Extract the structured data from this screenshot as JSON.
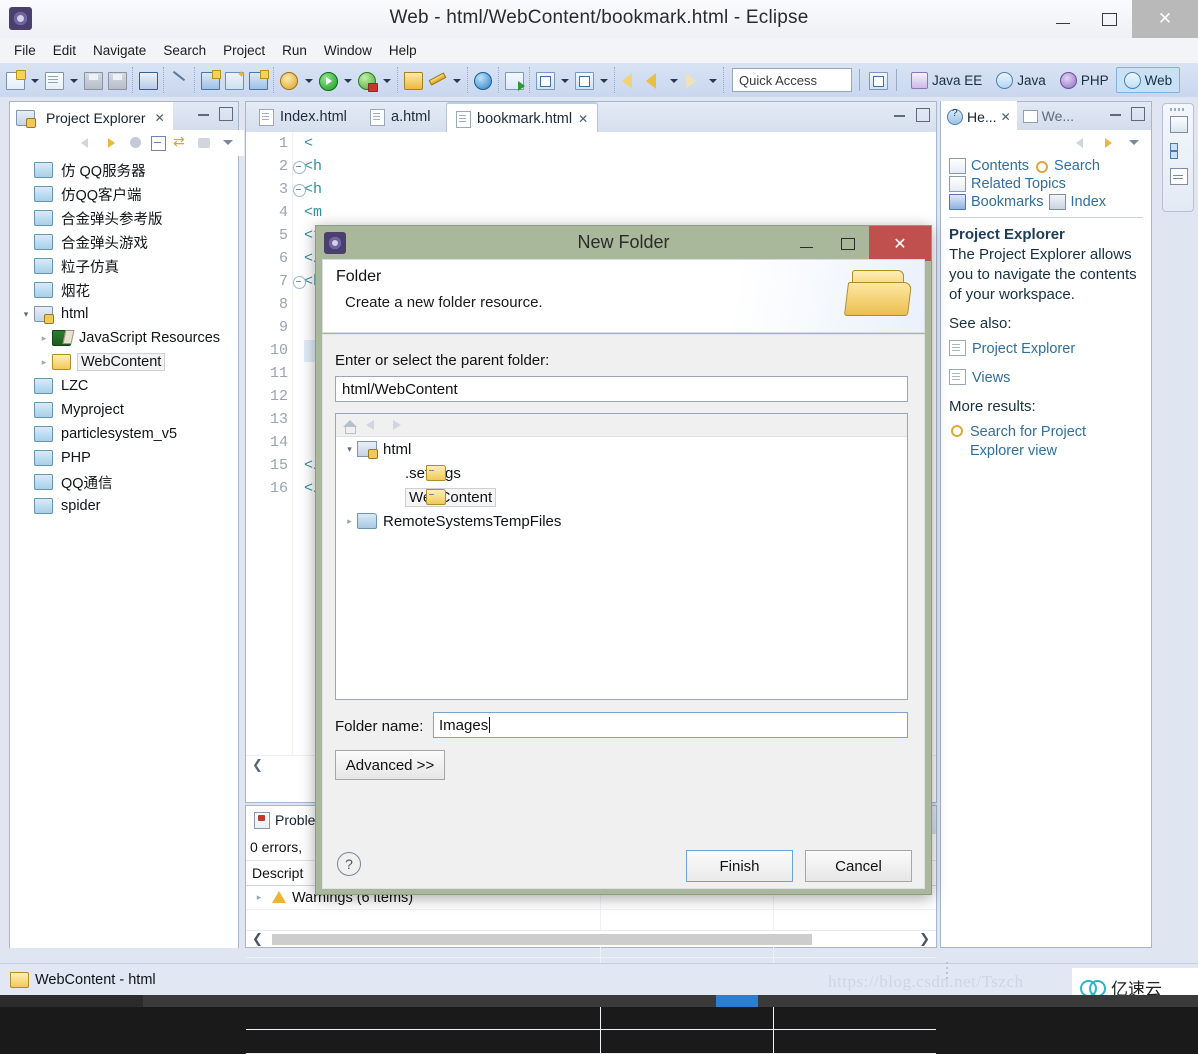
{
  "window": {
    "title": "Web - html/WebContent/bookmark.html - Eclipse",
    "icon": "eclipse-icon",
    "minimize": "–",
    "maximize": "❐",
    "close": "✕"
  },
  "menubar": {
    "items": [
      "File",
      "Edit",
      "Navigate",
      "Search",
      "Project",
      "Run",
      "Window",
      "Help"
    ]
  },
  "toolbar": {
    "quick_access_placeholder": "Quick Access",
    "perspectives": [
      {
        "label": "Java EE",
        "icon": "java-ee-perspective-icon",
        "active": false
      },
      {
        "label": "Java",
        "icon": "java-perspective-icon",
        "active": false
      },
      {
        "label": "PHP",
        "icon": "php-perspective-icon",
        "active": false
      },
      {
        "label": "Web",
        "icon": "web-perspective-icon",
        "active": true
      }
    ]
  },
  "project_explorer": {
    "tab_label": "Project Explorer",
    "tab_close": "✕",
    "items": [
      {
        "label": "仿 QQ服务器",
        "icon": "folder-icon",
        "indent": 0,
        "twisty": "none",
        "selected": false
      },
      {
        "label": "仿QQ客户端",
        "icon": "folder-icon",
        "indent": 0,
        "twisty": "none",
        "selected": false
      },
      {
        "label": "合金弹头参考版",
        "icon": "folder-icon",
        "indent": 0,
        "twisty": "none",
        "selected": false
      },
      {
        "label": "合金弹头游戏",
        "icon": "folder-icon",
        "indent": 0,
        "twisty": "none",
        "selected": false
      },
      {
        "label": "粒子仿真",
        "icon": "folder-icon",
        "indent": 0,
        "twisty": "none",
        "selected": false
      },
      {
        "label": "烟花",
        "icon": "folder-icon",
        "indent": 0,
        "twisty": "none",
        "selected": false
      },
      {
        "label": "html",
        "icon": "web-project-icon",
        "indent": 0,
        "twisty": "open",
        "selected": false
      },
      {
        "label": "JavaScript Resources",
        "icon": "javascript-resources-icon",
        "indent": 1,
        "twisty": "closed",
        "selected": false
      },
      {
        "label": "WebContent",
        "icon": "open-folder-icon",
        "indent": 1,
        "twisty": "closed",
        "selected": true
      },
      {
        "label": "LZC",
        "icon": "folder-icon",
        "indent": 0,
        "twisty": "none",
        "selected": false
      },
      {
        "label": "Myproject",
        "icon": "folder-icon",
        "indent": 0,
        "twisty": "none",
        "selected": false
      },
      {
        "label": "particlesystem_v5",
        "icon": "folder-icon",
        "indent": 0,
        "twisty": "none",
        "selected": false
      },
      {
        "label": "PHP",
        "icon": "folder-icon",
        "indent": 0,
        "twisty": "none",
        "selected": false
      },
      {
        "label": "QQ通信",
        "icon": "folder-icon",
        "indent": 0,
        "twisty": "none",
        "selected": false
      },
      {
        "label": "spider",
        "icon": "folder-icon",
        "indent": 0,
        "twisty": "none",
        "selected": false
      }
    ]
  },
  "editor": {
    "tabs": [
      {
        "label": "Index.html",
        "active": false,
        "close": ""
      },
      {
        "label": "a.html",
        "active": false,
        "close": ""
      },
      {
        "label": "bookmark.html",
        "active": true,
        "close": "✕"
      }
    ],
    "lines": [
      {
        "no": "1",
        "text": "<",
        "fold": false,
        "marker": "none"
      },
      {
        "no": "2",
        "text": "<h",
        "fold": true,
        "marker": "none"
      },
      {
        "no": "3",
        "text": "<h",
        "fold": true,
        "marker": "none"
      },
      {
        "no": "4",
        "text": "<m",
        "fold": false,
        "marker": "none"
      },
      {
        "no": "5",
        "text": "<t",
        "fold": false,
        "marker": "none"
      },
      {
        "no": "6",
        "text": "</",
        "fold": false,
        "marker": "none"
      },
      {
        "no": "7",
        "text": "<b",
        "fold": true,
        "marker": "none"
      },
      {
        "no": "8",
        "text": "",
        "fold": false,
        "marker": "none"
      },
      {
        "no": "9",
        "text": "",
        "fold": false,
        "marker": "none"
      },
      {
        "no": "10",
        "text": "",
        "fold": false,
        "marker": "selection"
      },
      {
        "no": "11",
        "text": "",
        "fold": false,
        "marker": "selection"
      },
      {
        "no": "12",
        "text": "",
        "fold": false,
        "marker": "warning"
      },
      {
        "no": "13",
        "text": "",
        "fold": false,
        "marker": "warning"
      },
      {
        "no": "14",
        "text": "",
        "fold": false,
        "marker": "warning"
      },
      {
        "no": "15",
        "text": "</",
        "fold": false,
        "marker": "none"
      },
      {
        "no": "16",
        "text": "</",
        "fold": false,
        "marker": "none"
      }
    ]
  },
  "problems": {
    "tab_label": "Proble",
    "summary": "0 errors,",
    "columns": [
      "Descript",
      "",
      ""
    ],
    "rows": [
      {
        "label": "Warnings (6 items)",
        "icon": "warning-icon",
        "twisty": "closed"
      }
    ],
    "empty_rows": 6
  },
  "help": {
    "tabs": [
      {
        "label": "He...",
        "icon": "help-icon",
        "active": true,
        "close": "✕"
      },
      {
        "label": "We...",
        "icon": "web-browser-icon",
        "active": false,
        "close": ""
      }
    ],
    "links_row1": [
      "Contents",
      "Search"
    ],
    "links_row2": [
      "Related Topics"
    ],
    "links_row3": [
      "Bookmarks",
      "Index"
    ],
    "topic_title": "Project Explorer",
    "topic_body": "The Project Explorer allows you to navigate the contents of your workspace.",
    "see_also_label": "See also:",
    "see_also": [
      "Project Explorer",
      "Views"
    ],
    "more_results_label": "More results:",
    "more_results": [
      "Search for Project Explorer view"
    ]
  },
  "dialog": {
    "title": "New Folder",
    "icon": "eclipse-icon",
    "minimize": "–",
    "maximize": "❐",
    "close": "✕",
    "header_title": "Folder",
    "header_subtitle": "Create a new folder resource.",
    "header_icon": "open-folder-large-icon",
    "parent_label": "Enter or select the parent folder:",
    "parent_value": "html/WebContent",
    "tree": [
      {
        "label": "html",
        "icon": "web-project-icon",
        "indent": 0,
        "twisty": "open",
        "selected": false
      },
      {
        "label": ".settings",
        "icon": "open-folder-icon",
        "indent": 1,
        "twisty": "none",
        "selected": false
      },
      {
        "label": "WebContent",
        "icon": "open-folder-icon",
        "indent": 1,
        "twisty": "none",
        "selected": true
      },
      {
        "label": "RemoteSystemsTempFiles",
        "icon": "folder-blue-icon",
        "indent": 0,
        "twisty": "closed",
        "selected": false
      }
    ],
    "folder_name_label": "Folder name:",
    "folder_name_value": "Images",
    "advanced_label": "Advanced >>",
    "help_glyph": "?",
    "finish_label": "Finish",
    "cancel_label": "Cancel"
  },
  "status_bar": {
    "text": "WebContent - html",
    "icon": "open-folder-icon"
  },
  "watermark": {
    "url": "https://blog.csdn.net/Tszch",
    "brand": "亿速云"
  },
  "colors": {
    "accent": "#2a7fd4",
    "dialog_frame": "#a9b79a",
    "toolbar_bg": "#c9d7ef",
    "close_red": "#c0504d",
    "link": "#2f6f9f"
  }
}
